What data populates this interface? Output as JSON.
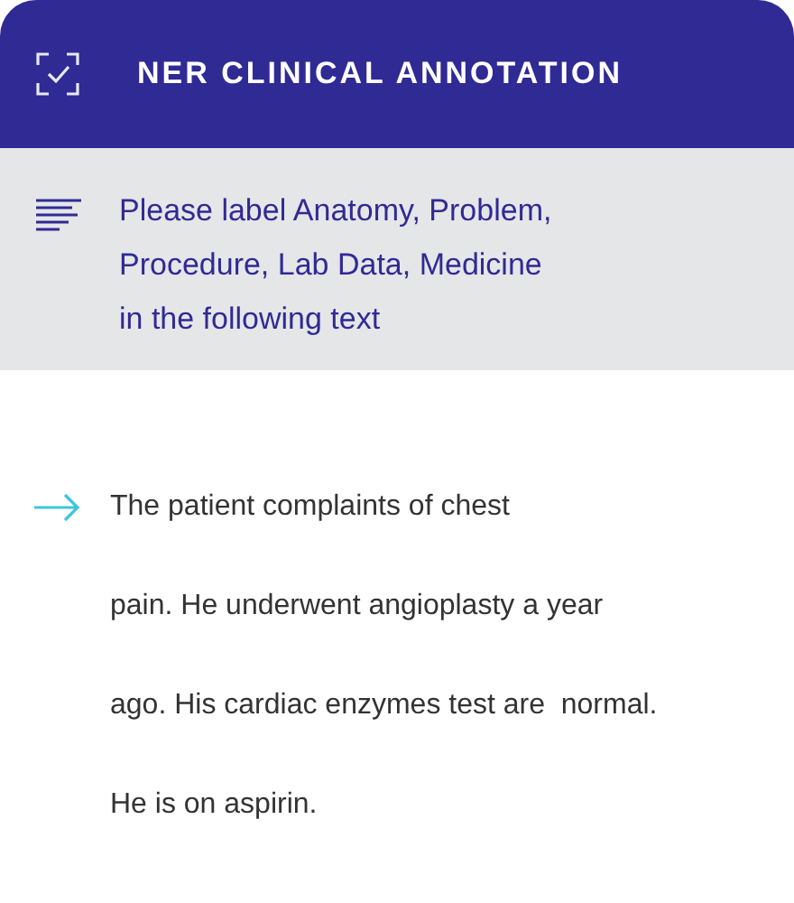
{
  "header": {
    "title": "NER CLINICAL ANNOTATION"
  },
  "instruction": {
    "lines": [
      "Please label Anatomy, Problem,",
      "Procedure, Lab Data, Medicine",
      "in the following text"
    ]
  },
  "passage": {
    "lines": [
      "The patient complaints of chest",
      "pain. He underwent angioplasty a year",
      "ago. His cardiac enzymes test are  normal.",
      "He is on aspirin."
    ]
  }
}
